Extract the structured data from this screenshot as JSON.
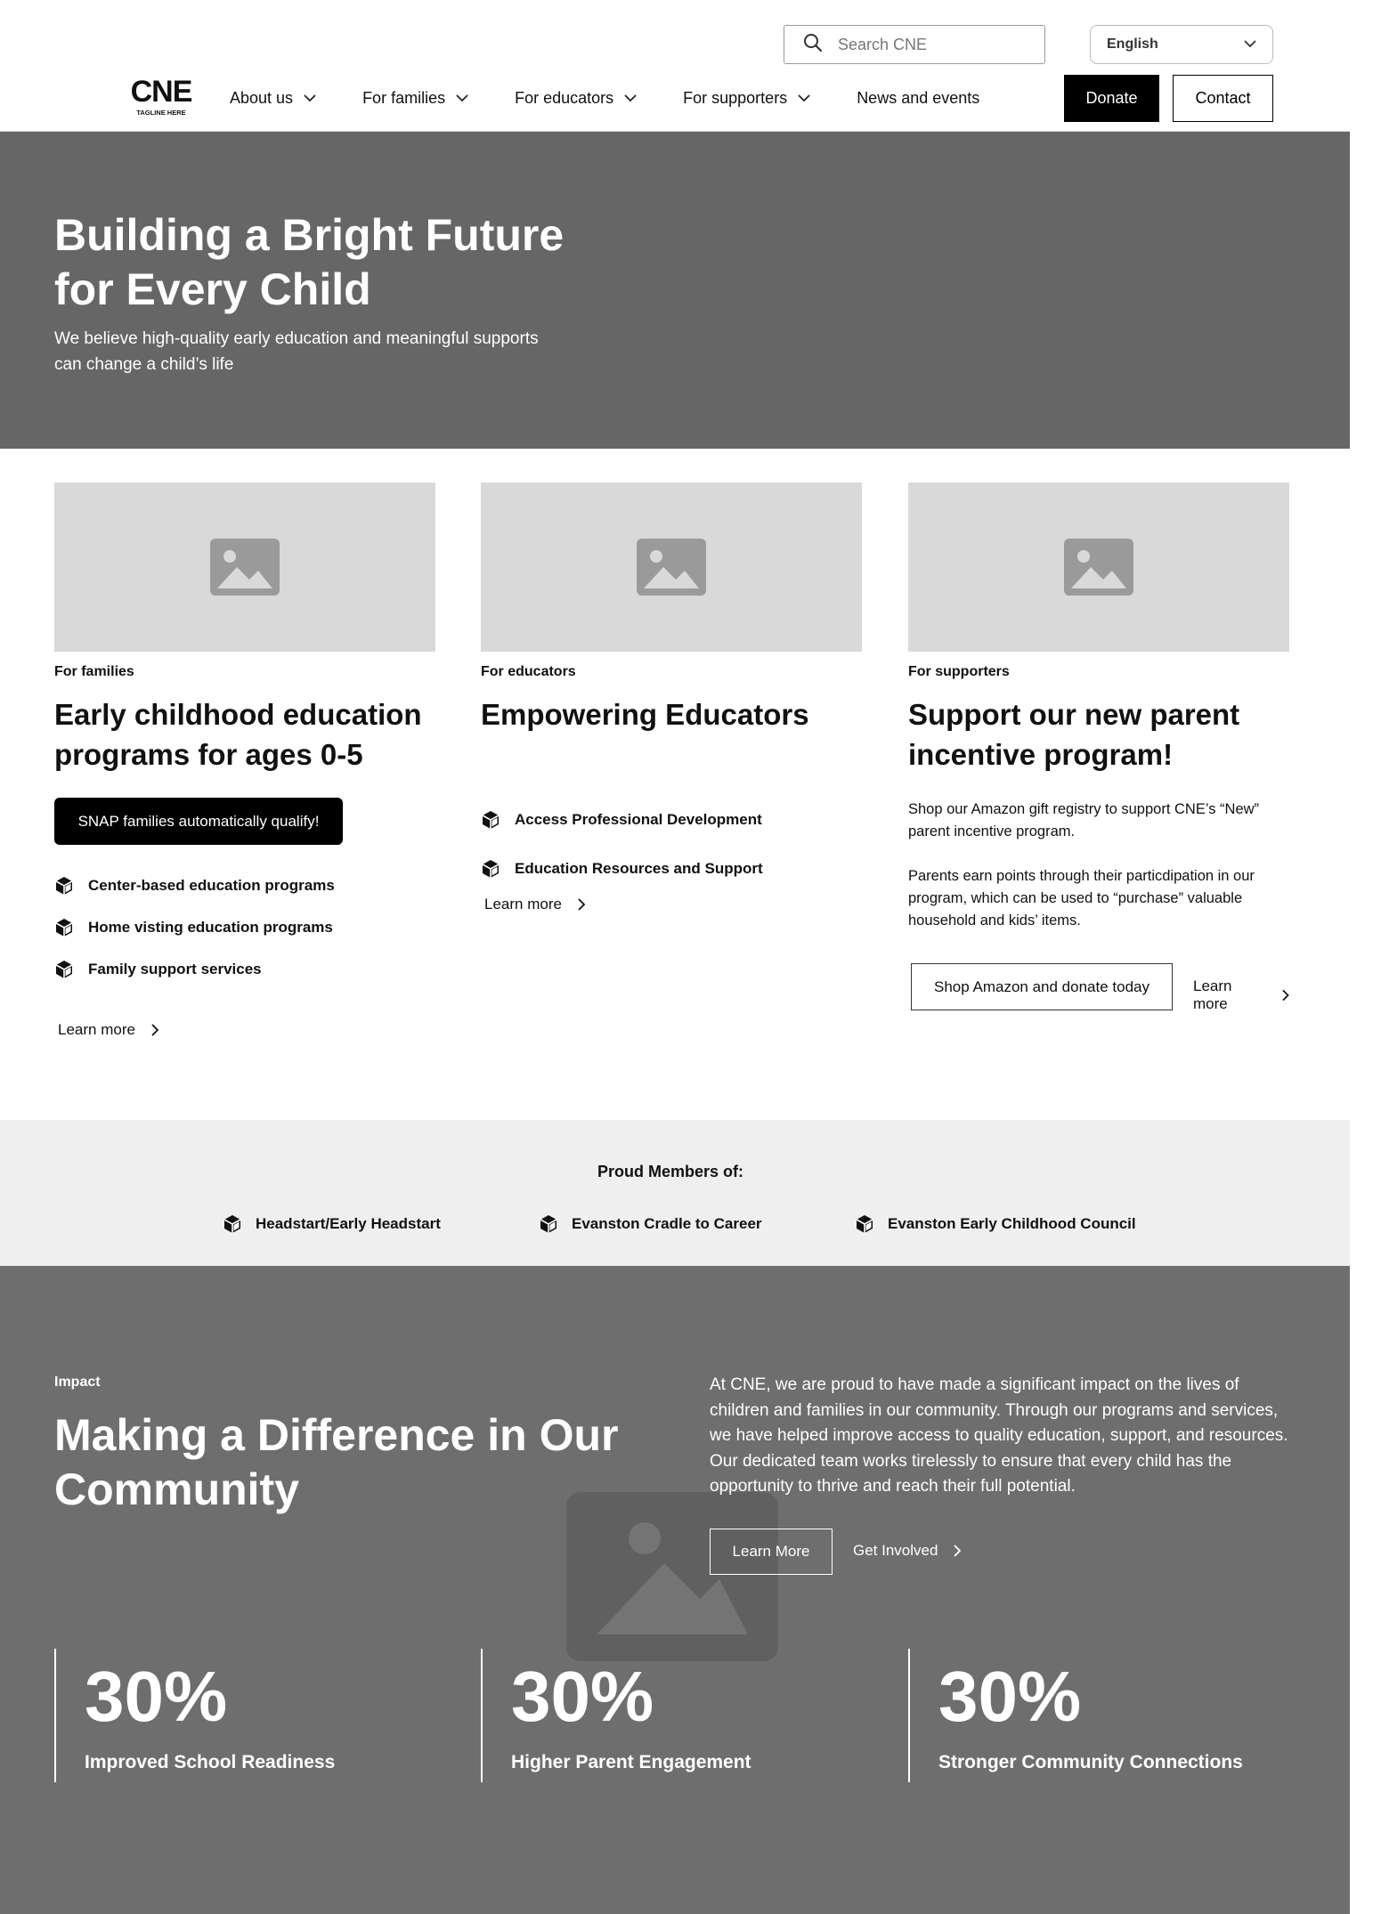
{
  "header": {
    "search_placeholder": "Search CNE",
    "language": "English",
    "logo_name": "CNE",
    "logo_tagline": "TAGLINE HERE",
    "nav": [
      {
        "label": "About us"
      },
      {
        "label": "For families"
      },
      {
        "label": "For educators"
      },
      {
        "label": "For supporters"
      },
      {
        "label": "News and events"
      }
    ],
    "donate_label": "Donate",
    "contact_label": "Contact"
  },
  "hero": {
    "title": "Building a Bright Future for Every Child",
    "subtitle": "We believe high-quality early education and meaningful supports can change a child’s life"
  },
  "cards": [
    {
      "category": "For families",
      "title": "Early childhood education programs for ages 0-5",
      "pill": "SNAP families automatically qualify!",
      "features": [
        "Center-based education programs",
        "Home visting education programs",
        "Family support services"
      ],
      "learn_more": "Learn more"
    },
    {
      "category": "For educators",
      "title": "Empowering Educators",
      "features": [
        "Access Professional Development",
        "Education Resources and Support"
      ],
      "learn_more": "Learn more"
    },
    {
      "category": "For supporters",
      "title": "Support our new parent incentive program!",
      "paragraph1": "Shop our Amazon gift registry to support CNE’s “New” parent incentive program.",
      "paragraph2": "Parents earn points through their particdipation in our program, which can be used to “purchase” valuable household and kids’ items.",
      "button": "Shop Amazon and donate today",
      "learn_more": "Learn more"
    }
  ],
  "members": {
    "title": "Proud Members of:",
    "items": [
      "Headstart/Early Headstart",
      "Evanston Cradle to Career",
      "Evanston Early Childhood Council"
    ]
  },
  "impact": {
    "eyebrow": "Impact",
    "title": "Making a Difference in Our Community",
    "paragraph": "At CNE, we are proud to have made a significant impact on the lives of children and families in our community. Through our programs and services, we have helped improve access to quality education, support, and resources. Our dedicated team works tirelessly to ensure that every child has the opportunity to thrive and reach their full potential.",
    "learn_more": "Learn More",
    "get_involved": "Get Involved",
    "stats": [
      {
        "value": "30%",
        "label": "Improved School Readiness"
      },
      {
        "value": "30%",
        "label": "Higher Parent Engagement"
      },
      {
        "value": "30%",
        "label": "Stronger Community Connections"
      }
    ]
  },
  "colors": {
    "hero_bg": "#666666",
    "impact_bg": "#6e6e6e",
    "members_bg": "#efefef",
    "placeholder": "#d9d9d9",
    "button_dark": "#000000"
  }
}
